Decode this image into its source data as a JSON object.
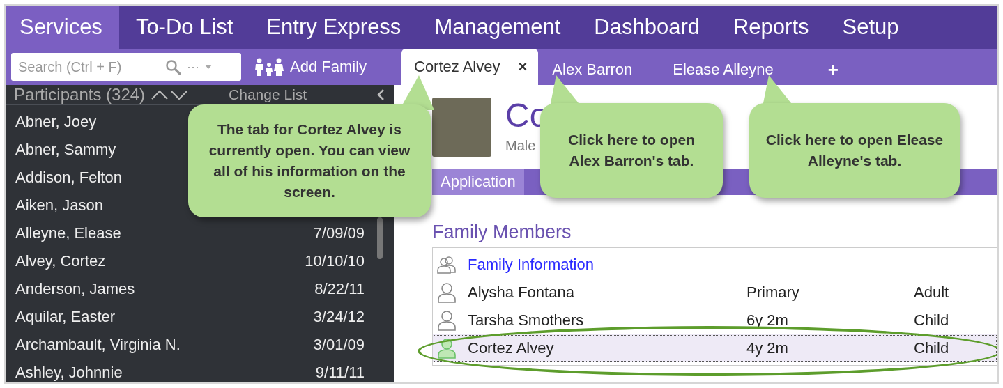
{
  "nav": [
    {
      "label": "Services",
      "selected": true
    },
    {
      "label": "To-Do List",
      "selected": false
    },
    {
      "label": "Entry Express",
      "selected": false
    },
    {
      "label": "Management",
      "selected": false
    },
    {
      "label": "Dashboard",
      "selected": false
    },
    {
      "label": "Reports",
      "selected": false
    },
    {
      "label": "Setup",
      "selected": false
    }
  ],
  "toolbar": {
    "search": {
      "placeholder": "Search (Ctrl + F)"
    },
    "more": "···",
    "add_family": "Add Family"
  },
  "record_tabs": [
    {
      "label": "Cortez Alvey",
      "selected": true,
      "close": "×"
    },
    {
      "label": "Alex Barron",
      "selected": false
    },
    {
      "label": "Elease Alleyne",
      "selected": false
    }
  ],
  "new_tab": "+",
  "sidebar": {
    "title": "Participants (324)",
    "change_list": "Change List",
    "items": [
      {
        "name": "Abner, Joey"
      },
      {
        "name": "Abner, Sammy"
      },
      {
        "name": "Addison, Felton"
      },
      {
        "name": "Aiken, Jason"
      },
      {
        "name": "Alleyne, Elease",
        "date": "7/09/09"
      },
      {
        "name": "Alvey, Cortez",
        "date": "10/10/10"
      },
      {
        "name": "Anderson, James",
        "date": "8/22/11"
      },
      {
        "name": "Aquilar, Easter",
        "date": "3/24/12"
      },
      {
        "name": "Archambault, Virginia N.",
        "date": "3/01/09"
      },
      {
        "name": "Ashley, Johnnie",
        "date": "9/11/11"
      }
    ]
  },
  "record": {
    "name": "Co",
    "details": [
      "Male"
    ],
    "subtabs": [
      {
        "label": "Application",
        "selected": true
      }
    ]
  },
  "family": {
    "title": "Family Members",
    "rows": [
      {
        "kind": "link",
        "name": "Family Information"
      },
      {
        "kind": "member",
        "name": "Alysha Fontana",
        "column_2": "Primary",
        "column_3": "Adult",
        "selected": false
      },
      {
        "kind": "member",
        "name": "Tarsha Smothers",
        "column_2": "6y 2m",
        "column_3": "Child",
        "selected": false
      },
      {
        "kind": "member",
        "name": "Cortez Alvey",
        "column_2": "4y 2m",
        "column_3": "Child",
        "selected": true
      }
    ]
  },
  "callouts": [
    {
      "text": "The tab for Cortez Alvey is currently open.  You can view all of his information on the screen."
    },
    {
      "text": "Click here to open Alex Barron's tab."
    },
    {
      "text": "Click here to open Elease Alleyne's tab."
    }
  ]
}
